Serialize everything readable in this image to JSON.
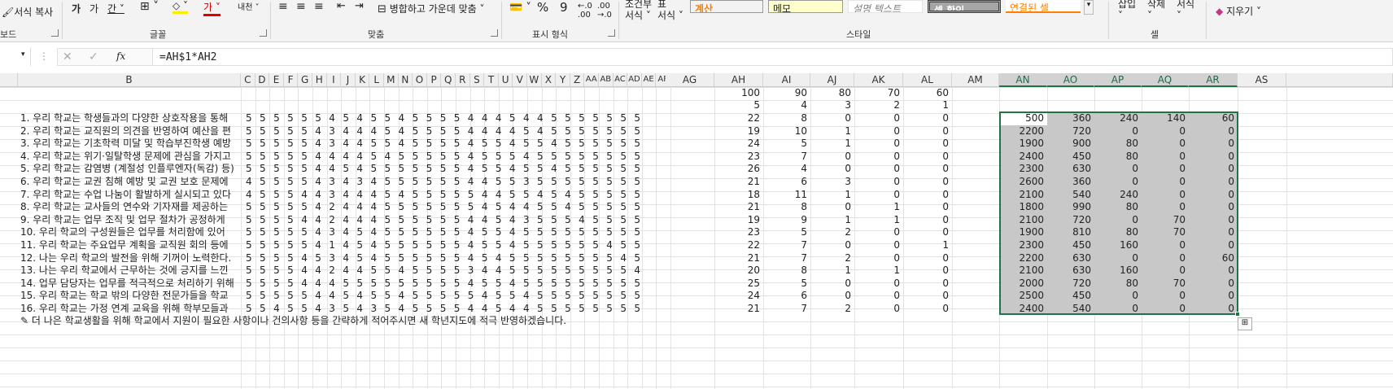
{
  "ribbon": {
    "paint": "서식 복사",
    "merge": "병합하고 가운데 맞춤",
    "percent": "%",
    "comma": "9",
    "condfmt": [
      "조건부",
      "서식"
    ],
    "table": [
      "표",
      "서식"
    ],
    "styles": [
      "계산",
      "메모",
      "설명 텍스트",
      "셀 확인",
      "연결된 셀"
    ],
    "insert": "삽입",
    "delete": "삭제",
    "format": "서식",
    "clear": "지우기",
    "groups": [
      "보드",
      "글꼴",
      "맞춤",
      "표시 형식",
      "스타일",
      "셀"
    ]
  },
  "formula": "=AH$1*AH2",
  "colors": {
    "accent": "#217346",
    "selection": "#c8c8c8"
  },
  "columns": [
    "B",
    "C",
    "D",
    "E",
    "F",
    "G",
    "H",
    "I",
    "J",
    "K",
    "L",
    "M",
    "N",
    "O",
    "P",
    "Q",
    "R",
    "S",
    "T",
    "U",
    "V",
    "W",
    "X",
    "Y",
    "Z",
    "AA",
    "AB",
    "AC",
    "AD",
    "AE",
    "AF",
    "AG",
    "AH",
    "AI",
    "AJ",
    "AK",
    "AL",
    "AM",
    "AN",
    "AO",
    "AP",
    "AQ",
    "AR",
    "AS"
  ],
  "header_row1": [
    "100",
    "90",
    "80",
    "70",
    "60"
  ],
  "header_row2": [
    "5",
    "4",
    "3",
    "2",
    "1"
  ],
  "rows": [
    {
      "q": "1. 우리 학교는 학생들과의 다양한 상호작용을 통해",
      "v": "5 5 5 5 5 5 4 5 4 5 5 4 5 5 5 5 4 4 4 5 4 4 5 5 5 5 5 5 5",
      "ah": [
        "22",
        "8",
        "0",
        "0",
        "0"
      ],
      "an": [
        "500",
        "360",
        "240",
        "140",
        "60"
      ]
    },
    {
      "q": "2. 우리 학교는 교직원의 의견을 반영하여 예산을 편",
      "v": "5 5 5 5 5 4 3 4 4 4 5 4 5 5 5 5 4 4 4 4 5 4 5 5 5 5 5 5 5",
      "ah": [
        "19",
        "10",
        "1",
        "0",
        "0"
      ],
      "an": [
        "2200",
        "720",
        "0",
        "0",
        "0"
      ]
    },
    {
      "q": "3. 우리 학교는 기초학력 미달 및 학습부진학생 예방",
      "v": "5 5 5 5 5 4 3 4 4 5 5 4 5 5 5 5 4 5 5 4 5 5 4 5 5 5 5 5 5",
      "ah": [
        "24",
        "5",
        "1",
        "0",
        "0"
      ],
      "an": [
        "1900",
        "900",
        "80",
        "0",
        "0"
      ]
    },
    {
      "q": "4. 우리 학교는 위기·일탈학생 문제에 관심을 가지고",
      "v": "5 5 5 5 5 4 4 4 4 5 4 5 5 5 5 5 4 5 5 5 4 5 5 5 5 5 5 5 5",
      "ah": [
        "23",
        "7",
        "0",
        "0",
        "0"
      ],
      "an": [
        "2400",
        "450",
        "80",
        "0",
        "0"
      ]
    },
    {
      "q": "5. 우리 학교는 감염병 (계절성 인플루엔자(독감) 등)",
      "v": "5 5 5 5 5 4 4 5 4 5 5 5 5 5 5 5 4 5 5 4 5 5 4 5 5 5 5 5 5",
      "ah": [
        "26",
        "4",
        "0",
        "0",
        "0"
      ],
      "an": [
        "2300",
        "630",
        "0",
        "0",
        "0"
      ]
    },
    {
      "q": "6. 우리 학교는 교권 침해 예방 및 교권 보호 문제에",
      "v": "4 5 5 5 5 4 3 4 3 4 5 5 5 5 5 5 4 4 5 5 3 5 5 5 5 5 5 5 5",
      "ah": [
        "21",
        "6",
        "3",
        "0",
        "0"
      ],
      "an": [
        "2600",
        "360",
        "0",
        "0",
        "0"
      ]
    },
    {
      "q": "7. 우리 학교는 수업 나눔이 활발하게 실시되고 있다",
      "v": "4 5 5 5 4 4 3 4 4 4 5 4 5 5 5 5 5 4 4 5 5 4 5 4 5 5 5 5 5",
      "ah": [
        "18",
        "11",
        "1",
        "0",
        "0"
      ],
      "an": [
        "2100",
        "540",
        "240",
        "0",
        "0"
      ]
    },
    {
      "q": "8. 우리 학교는 교사들의 연수와 기자재를 제공하는",
      "v": "5 5 5 5 5 4 2 4 4 4 5 5 5 5 5 5 5 4 5 4 4 5 5 4 5 5 5 5 5",
      "ah": [
        "21",
        "8",
        "0",
        "1",
        "0"
      ],
      "an": [
        "1800",
        "990",
        "80",
        "0",
        "0"
      ]
    },
    {
      "q": "9. 우리 학교는 업무 조직 및 업무 절차가 공정하게",
      "v": "5 5 5 5 4 4 2 4 4 4 5 5 5 5 5 5 4 4 5 4 3 5 5 5 4 5 5 5 5",
      "ah": [
        "19",
        "9",
        "1",
        "1",
        "0"
      ],
      "an": [
        "2100",
        "720",
        "0",
        "70",
        "0"
      ]
    },
    {
      "q": "10. 우리 학교의 구성원들은 업무를 처리함에 있어",
      "v": "5 5 5 5 5 4 3 4 5 4 5 5 5 5 5 5 4 5 5 4 5 5 5 5 5 5 5 5 5",
      "ah": [
        "23",
        "5",
        "2",
        "0",
        "0"
      ],
      "an": [
        "1900",
        "810",
        "80",
        "70",
        "0"
      ]
    },
    {
      "q": "11. 우리 학교는 주요업무 계획을 교직원 회의 등에",
      "v": "5 5 5 5 5 4 1 4 5 4 5 5 5 5 5 5 4 5 5 4 5 5 5 5 5 5 4 5 5",
      "ah": [
        "22",
        "7",
        "0",
        "0",
        "1"
      ],
      "an": [
        "2300",
        "450",
        "160",
        "0",
        "0"
      ]
    },
    {
      "q": "12. 나는 우리 학교의 발전을 위해 기꺼이 노력한다.",
      "v": "5 5 5 5 4 5 3 4 5 4 5 5 5 5 5 5 4 5 4 5 5 5 5 5 5 5 5 4 5",
      "ah": [
        "21",
        "7",
        "2",
        "0",
        "0"
      ],
      "an": [
        "2200",
        "630",
        "0",
        "0",
        "60"
      ]
    },
    {
      "q": "13. 나는 우리 학교에서 근무하는 것에 긍지를 느낀",
      "v": "5 5 5 5 4 4 2 4 4 5 5 4 5 5 5 5 3 4 4 5 5 5 5 5 5 5 5 5 4",
      "ah": [
        "20",
        "8",
        "1",
        "1",
        "0"
      ],
      "an": [
        "2100",
        "630",
        "160",
        "0",
        "0"
      ]
    },
    {
      "q": "14. 업무 담당자는 업무를 적극적으로 처리하기 위해",
      "v": "5 5 5 5 4 4 4 5 5 5 5 5 5 5 5 5 4 5 5 4 5 5 5 5 5 5 5 5 5",
      "ah": [
        "25",
        "5",
        "0",
        "0",
        "0"
      ],
      "an": [
        "2000",
        "720",
        "80",
        "70",
        "0"
      ]
    },
    {
      "q": "15. 우리 학교는 학교 밖의 다양한 전문가들을 학교",
      "v": "5 5 5 5 5 4 4 5 4 5 5 4 5 5 5 5 5 4 5 5 4 5 5 5 5 5 5 5 5",
      "ah": [
        "24",
        "6",
        "0",
        "0",
        "0"
      ],
      "an": [
        "2500",
        "450",
        "0",
        "0",
        "0"
      ]
    },
    {
      "q": "16. 우리 학교는 가정 연계 교육을 위해 학부모들과",
      "v": "5 5 4 5 5 4 3 5 4 3 5 4 5 5 5 5 4 4 5 4 4 5 5 5 5 5 5 5 5",
      "ah": [
        "21",
        "7",
        "2",
        "0",
        "0"
      ],
      "an": [
        "2400",
        "540",
        "0",
        "0",
        "0"
      ]
    }
  ],
  "note": "✎ 더 나은 학교생활을 위해 학교에서 지원이 필요한 사항이나 건의사항 등을 간략하게 적어주시면 새 학년지도에 적극 반영하겠습니다."
}
